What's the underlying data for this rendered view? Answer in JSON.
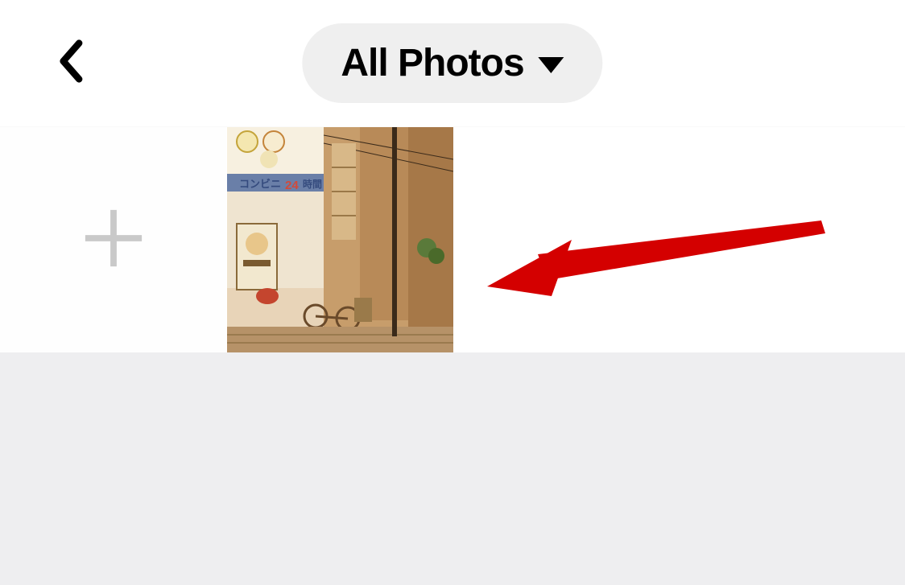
{
  "header": {
    "title": "All Photos"
  },
  "grid": {
    "add_tile": true,
    "photo_thumbnail_label": "Street scene illustration",
    "photo_signage_text_1": "コンビニ",
    "photo_signage_text_2": "24",
    "photo_signage_text_3": "時間"
  },
  "annotation": {
    "arrow_color": "#d40000"
  }
}
